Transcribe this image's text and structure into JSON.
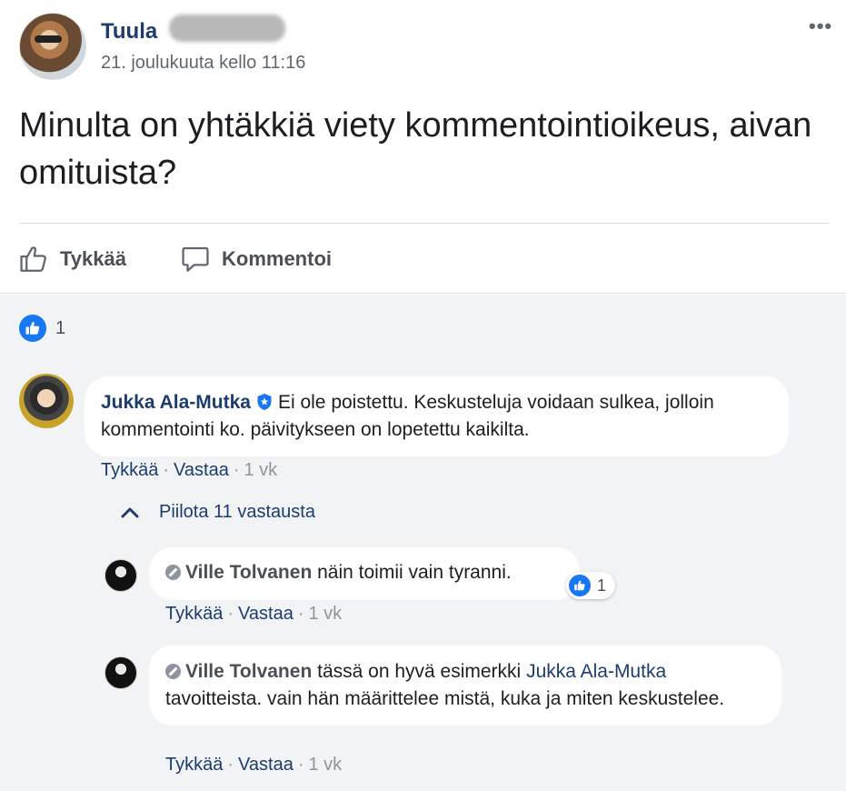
{
  "post": {
    "author": "Tuula",
    "timestamp": "21. joulukuuta kello 11:16",
    "text": "Minulta on yhtäkkiä viety kommentointioikeus, aivan omituista?",
    "more_label": "•••"
  },
  "actions": {
    "like_label": "Tykkää",
    "comment_label": "Kommentoi"
  },
  "reactions": {
    "count": "1"
  },
  "comments": [
    {
      "author": "Jukka Ala-Mutka",
      "verified": true,
      "text": "Ei ole poistettu. Keskusteluja voidaan sulkea, jolloin kommentointi ko. päivitykseen on lopetettu kaikilta.",
      "like_label": "Tykkää",
      "reply_label": "Vastaa",
      "age": "1 vk"
    }
  ],
  "replies_toggle": "Piilota 11 vastausta",
  "replies": [
    {
      "author": "Ville Tolvanen",
      "text": "näin toimii vain tyranni.",
      "reaction_count": "1",
      "like_label": "Tykkää",
      "reply_label": "Vastaa",
      "age": "1 vk"
    },
    {
      "author": "Ville Tolvanen",
      "text_before": "tässä on hyvä esimerkki",
      "mention": "Jukka Ala-Mutka",
      "text_after": "tavoitteista. vain hän määrittelee mistä, kuka ja miten keskustelee.",
      "like_label": "Tykkää",
      "reply_label": "Vastaa",
      "age": "1 vk"
    }
  ],
  "colors": {
    "link": "#1d3c6e",
    "like_blue": "#1877f2",
    "comments_bg": "#f2f3f5"
  }
}
